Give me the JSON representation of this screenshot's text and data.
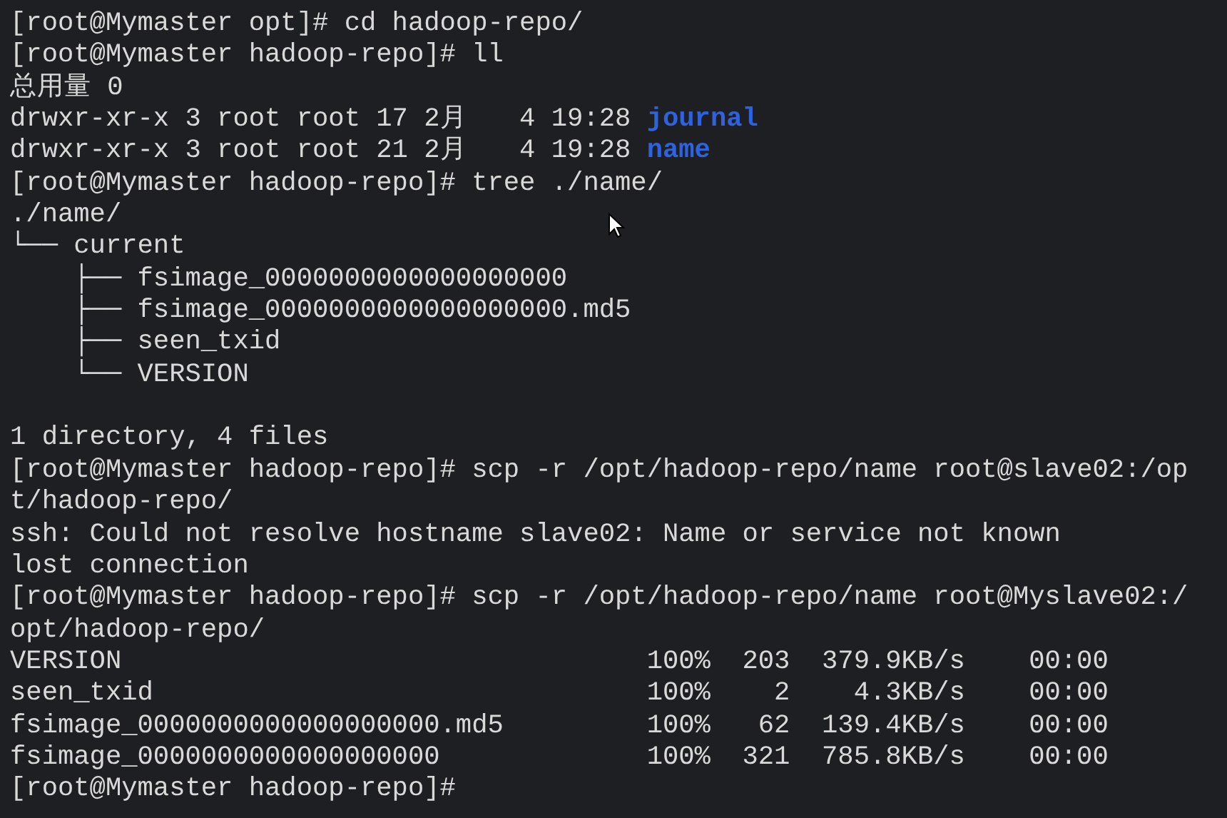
{
  "terminal": {
    "lines": [
      {
        "kind": "text",
        "text": "[root@Mymaster opt]# cd hadoop-repo/"
      },
      {
        "kind": "text",
        "text": "[root@Mymaster hadoop-repo]# ll"
      },
      {
        "kind": "text",
        "text": "总用量 0"
      },
      {
        "kind": "ls",
        "info": "drwxr-xr-x 3 root root 17 2月",
        "time": "4 19:28",
        "name": "journal",
        "color": "#2f63dd"
      },
      {
        "kind": "ls",
        "info": "drwxr-xr-x 3 root root 21 2月",
        "time": "4 19:28",
        "name": "name",
        "color": "#2f63dd"
      },
      {
        "kind": "text",
        "text": "[root@Mymaster hadoop-repo]# tree ./name/"
      },
      {
        "kind": "text",
        "text": "./name/"
      },
      {
        "kind": "text",
        "text": "└── current"
      },
      {
        "kind": "text",
        "text": "    ├── fsimage_0000000000000000000"
      },
      {
        "kind": "text",
        "text": "    ├── fsimage_0000000000000000000.md5"
      },
      {
        "kind": "text",
        "text": "    ├── seen_txid"
      },
      {
        "kind": "text",
        "text": "    └── VERSION"
      },
      {
        "kind": "blank"
      },
      {
        "kind": "text",
        "text": "1 directory, 4 files"
      },
      {
        "kind": "text",
        "text": "[root@Mymaster hadoop-repo]# scp -r /opt/hadoop-repo/name root@slave02:/op"
      },
      {
        "kind": "text",
        "text": "t/hadoop-repo/"
      },
      {
        "kind": "text",
        "text": "ssh: Could not resolve hostname slave02: Name or service not known"
      },
      {
        "kind": "text",
        "text": "lost connection"
      },
      {
        "kind": "text",
        "text": "[root@Mymaster hadoop-repo]# scp -r /opt/hadoop-repo/name root@Myslave02:/"
      },
      {
        "kind": "text",
        "text": "opt/hadoop-repo/"
      },
      {
        "kind": "transfer",
        "file": "VERSION",
        "percent": "100%",
        "size": "203",
        "speed": "379.9KB/s",
        "eta": "00:00"
      },
      {
        "kind": "transfer",
        "file": "seen_txid",
        "percent": "100%",
        "size": "2",
        "speed": "4.3KB/s",
        "eta": "00:00"
      },
      {
        "kind": "transfer",
        "file": "fsimage_0000000000000000000.md5",
        "percent": "100%",
        "size": "62",
        "speed": "139.4KB/s",
        "eta": "00:00"
      },
      {
        "kind": "transfer",
        "file": "fsimage_0000000000000000000",
        "percent": "100%",
        "size": "321",
        "speed": "785.8KB/s",
        "eta": "00:00"
      },
      {
        "kind": "text",
        "text": "[root@Mymaster hadoop-repo]#"
      }
    ]
  }
}
